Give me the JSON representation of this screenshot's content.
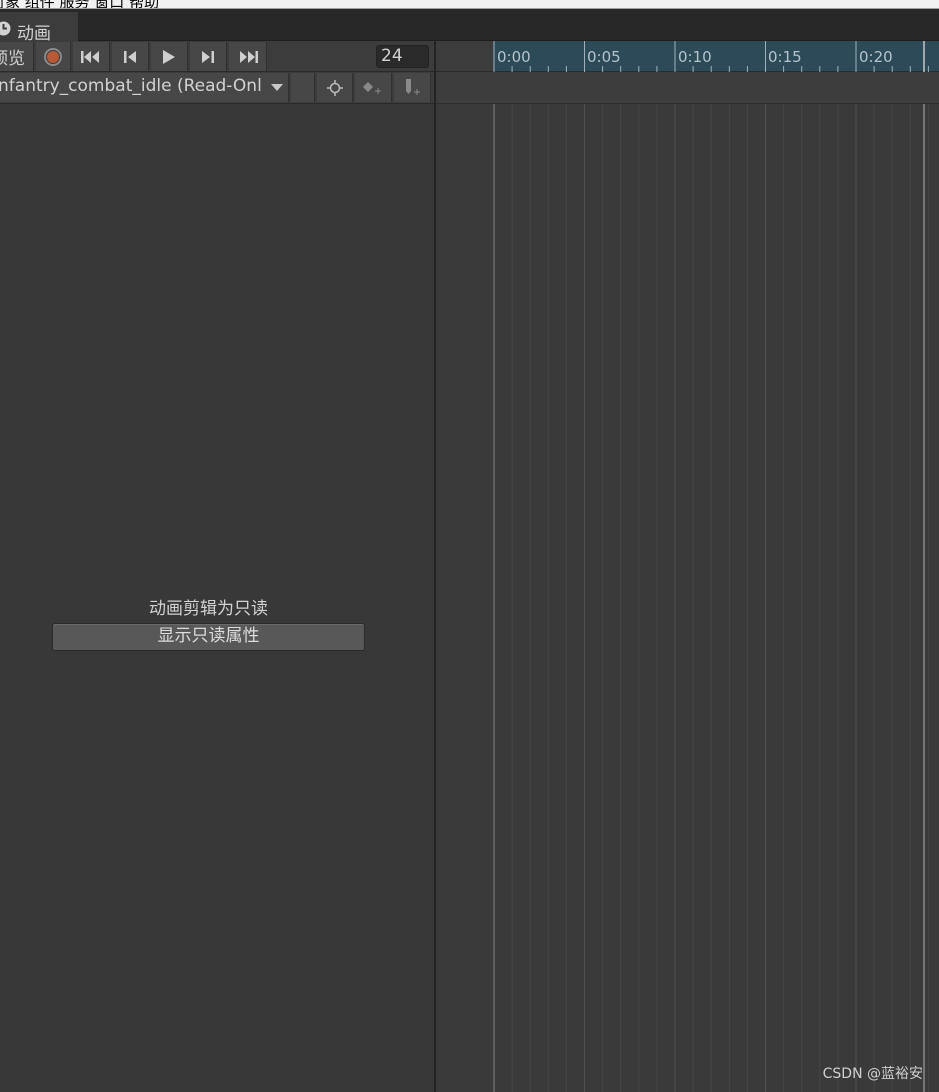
{
  "menu": {
    "items_text": "对象   组件   服务   窗口   帮助"
  },
  "window": {
    "tab_label": "动画"
  },
  "toolbar": {
    "preview_label": "预览",
    "frame_value": "24"
  },
  "clip": {
    "name": "Infantry_combat_idle (Read-Onl"
  },
  "main": {
    "readonly_message": "动画剪辑为只读",
    "show_readonly_button": "显示只读属性"
  },
  "timeline": {
    "tick_labels": [
      "0:00",
      "0:05",
      "0:10",
      "0:15",
      "0:20"
    ]
  },
  "watermark": "CSDN @蓝裕安",
  "colors": {
    "record_accent": "#b75a38",
    "ruler_background": "#2c4a57"
  }
}
